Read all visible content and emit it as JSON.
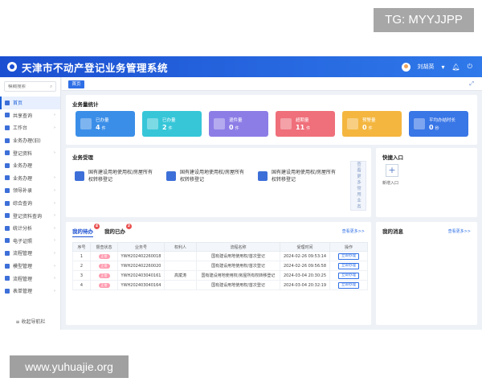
{
  "watermarks": {
    "top_right": "TG: MYYJJPP",
    "bottom_left": "www.yuhuajie.org"
  },
  "header": {
    "title": "天津市不动产登记业务管理系统",
    "user": "刘胡英"
  },
  "sidebar": {
    "search_placeholder": "模糊搜索",
    "items": [
      {
        "label": "首页",
        "active": true
      },
      {
        "label": "共享查询"
      },
      {
        "label": "工作台"
      },
      {
        "label": "业务办理(旧)"
      },
      {
        "label": "登记资料"
      },
      {
        "label": "业务办理"
      },
      {
        "label": "业务办理"
      },
      {
        "label": "领导补录"
      },
      {
        "label": "综合查询"
      },
      {
        "label": "登记资料查询"
      },
      {
        "label": "统计分析"
      },
      {
        "label": "电子证照"
      },
      {
        "label": "流程管理"
      },
      {
        "label": "模型管理"
      },
      {
        "label": "流程管理"
      },
      {
        "label": "表单管理"
      }
    ],
    "collapse_label": "收起导航栏"
  },
  "tabs": {
    "home": "首页"
  },
  "stats": {
    "title": "业务量统计",
    "cards": [
      {
        "label": "已办量",
        "value": "4",
        "unit": "件",
        "color": "#3a8ee8"
      },
      {
        "label": "已办量",
        "value": "2",
        "unit": "件",
        "color": "#36c6d8"
      },
      {
        "label": "退件量",
        "value": "0",
        "unit": "件",
        "color": "#8c7de6"
      },
      {
        "label": "超期量",
        "value": "11",
        "unit": "件",
        "color": "#ef6f7a"
      },
      {
        "label": "预警量",
        "value": "0",
        "unit": "件",
        "color": "#f4b63f"
      },
      {
        "label": "平均办结时长",
        "value": "0",
        "unit": "秒",
        "color": "#3976e6"
      }
    ]
  },
  "business": {
    "title": "业务受理",
    "items": [
      {
        "text": "国有建设用地使用权/房屋所有权转移登记"
      },
      {
        "text": "国有建设用地使用权/房屋所有权转移登记"
      },
      {
        "text": "国有建设用地使用权/房屋所有权转移登记"
      }
    ],
    "more": "查看更多常用业务"
  },
  "quick": {
    "title": "快捷入口",
    "add_label": "新增入口"
  },
  "todo": {
    "tab_todo": "我的待办",
    "tab_todo_count": "4",
    "tab_done": "我的已办",
    "tab_done_count": "2",
    "view_more": "查看更多>>",
    "columns": [
      "序号",
      "督查状态",
      "业务号",
      "权利人",
      "流程名称",
      "受理时间",
      "操作"
    ],
    "rows": [
      {
        "no": "1",
        "status": "正常",
        "code": "YWH202402260018",
        "owner": "",
        "flow": "国有建设用地使用权/首次登记",
        "time": "2024-02-26 09:53:14",
        "op": "立即办理"
      },
      {
        "no": "2",
        "status": "正常",
        "code": "YWH202402260020",
        "owner": "",
        "flow": "国有建设用地使用权/首次登记",
        "time": "2024-02-26 09:56:58",
        "op": "立即办理"
      },
      {
        "no": "3",
        "status": "正常",
        "code": "YWH202403040161",
        "owner": "高斌涛",
        "flow": "国有建设用地使用权/房屋所有权转移登记",
        "time": "2024-03-04 20:30:25",
        "op": "立即办理"
      },
      {
        "no": "4",
        "status": "正常",
        "code": "YWH202403040164",
        "owner": "",
        "flow": "国有建设用地使用权/首次登记",
        "time": "2024-03-04 20:32:19",
        "op": "立即办理"
      }
    ]
  },
  "messages": {
    "title": "我的消息",
    "view_more": "查看更多>>"
  }
}
